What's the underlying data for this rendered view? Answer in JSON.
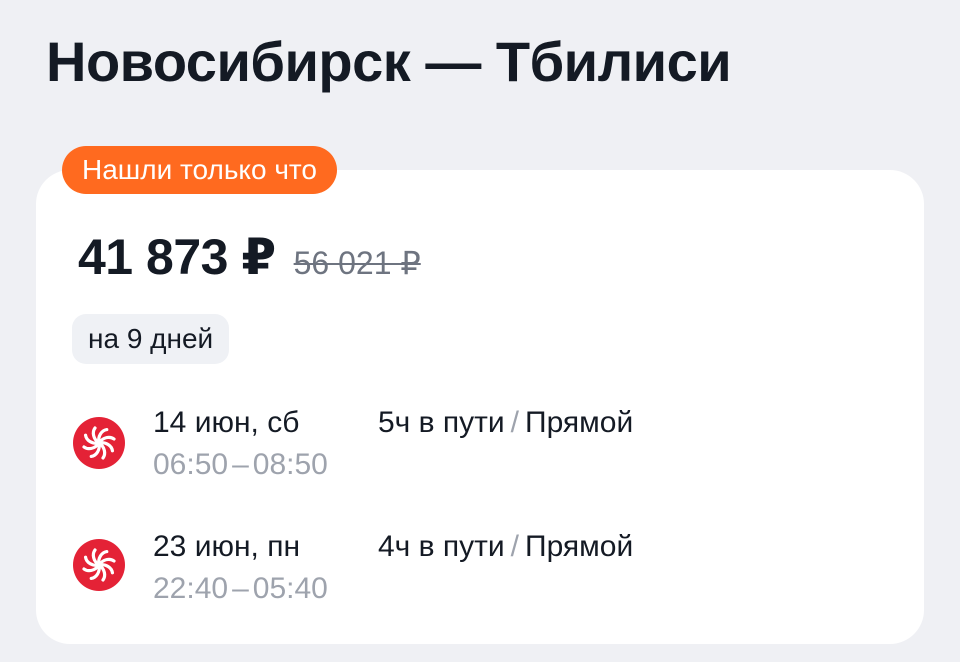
{
  "header": {
    "title": "Новосибирск — Тбилиси"
  },
  "offer": {
    "badge": "Нашли только что",
    "price": "41 873 ₽",
    "old_price": "56 021 ₽",
    "trip_length": "на 9 дней"
  },
  "segments": [
    {
      "date": "14 июн, сб",
      "depart": "06:50",
      "arrive": "08:50",
      "duration": "5ч в пути",
      "separator": "/",
      "stops": "Прямой",
      "airline_icon": "airline-logo-icon"
    },
    {
      "date": "23 июн, пн",
      "depart": "22:40",
      "arrive": "05:40",
      "duration": "4ч в пути",
      "separator": "/",
      "stops": "Прямой",
      "airline_icon": "airline-logo-icon"
    }
  ],
  "colors": {
    "background": "#eff0f4",
    "card": "#ffffff",
    "badge": "#ff6a1f",
    "airline_logo": "#e42236",
    "muted_text": "#9ea3ad"
  }
}
